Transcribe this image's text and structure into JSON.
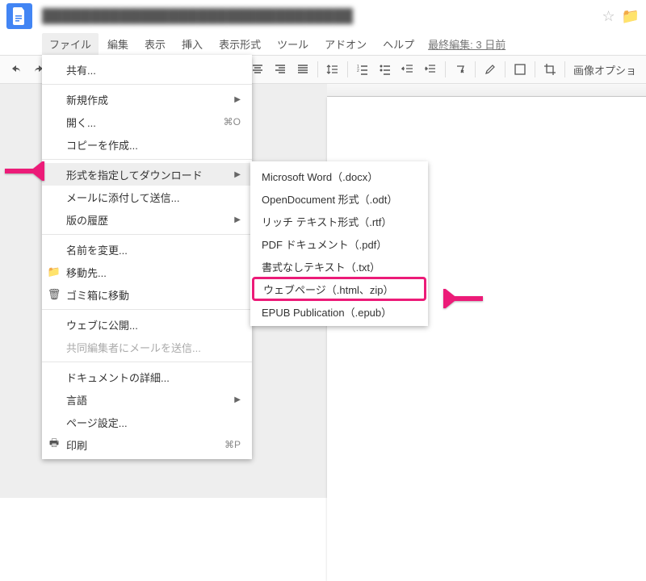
{
  "header": {
    "doc_title": "████████████████████████████████"
  },
  "menubar": {
    "items": [
      "ファイル",
      "編集",
      "表示",
      "挿入",
      "表示形式",
      "ツール",
      "アドオン",
      "ヘルプ"
    ],
    "last_edit": "最終編集: 3 日前"
  },
  "toolbar": {
    "right_label": "画像オプショ"
  },
  "file_menu": {
    "share": "共有...",
    "new": "新規作成",
    "open": "開く...",
    "open_shortcut": "⌘O",
    "make_copy": "コピーを作成...",
    "download_as": "形式を指定してダウンロード",
    "email_attach": "メールに添付して送信...",
    "revision": "版の履歴",
    "rename": "名前を変更...",
    "move": "移動先...",
    "trash": "ゴミ箱に移動",
    "publish": "ウェブに公開...",
    "email_collab": "共同編集者にメールを送信...",
    "details": "ドキュメントの詳細...",
    "language": "言語",
    "page_setup": "ページ設定...",
    "print": "印刷",
    "print_shortcut": "⌘P"
  },
  "download_submenu": {
    "docx": "Microsoft Word（.docx）",
    "odt": "OpenDocument 形式（.odt）",
    "rtf": "リッチ テキスト形式（.rtf）",
    "pdf": "PDF ドキュメント（.pdf）",
    "txt": "書式なしテキスト（.txt）",
    "html": "ウェブページ（.html、zip）",
    "epub": "EPUB Publication（.epub）"
  }
}
